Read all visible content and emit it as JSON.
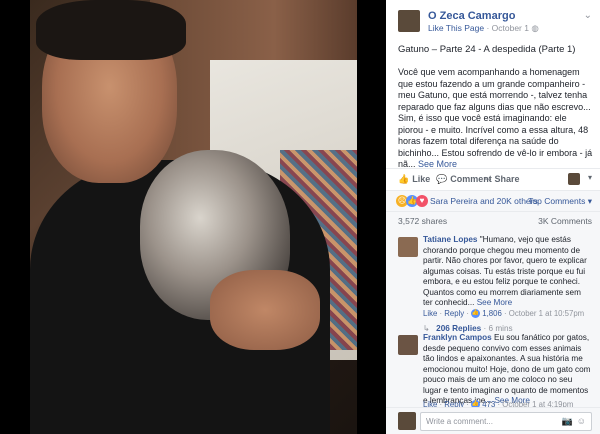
{
  "post": {
    "page_name": "O Zeca Camargo",
    "like_page": "Like This Page",
    "date": "October 1",
    "title": "Gatuno – Parte 24 - A despedida (Parte 1)",
    "body": "Você que vem acompanhando a homenagem que estou fazendo a um grande companheiro - meu Gatuno, que está morrendo -, talvez tenha reparado que faz alguns dias que não escrevo... Sim, é isso que você está imaginando: ele piorou - e muito. Incrível como a essa altura, 48 horas fazem total diferença na saúde do bichinho... Estou sofrendo de vê-lo ir embora - já nã...",
    "see_more": "See More"
  },
  "actions": {
    "like": "Like",
    "comment": "Comment",
    "share": "Share"
  },
  "reactions": {
    "text": "Sara Pereira and 20K others",
    "top_comments": "Top Comments"
  },
  "stats": {
    "shares": "3,572 shares",
    "comments": "3K Comments"
  },
  "comments": [
    {
      "name": "Tatiane Lopes",
      "text": "\"Humano, vejo que estás chorando porque chegou meu momento de partir. Não chores por favor, quero te explicar algumas coisas. Tu estás triste porque eu fui embora, e eu estou feliz porque te conheci. Quantos como eu morrem diariamente sem ter conhecid...",
      "more": "See More",
      "like": "Like",
      "reply": "Reply",
      "likes": "1,806",
      "date": "October 1 at 10:57pm",
      "replies": "206 Replies",
      "replies_ago": "6 mins"
    },
    {
      "name": "Franklyn Campos",
      "text": "Eu sou fanático por gatos, desde pequeno convivo com esses animais tão lindos e apaixonantes. A sua história me emocionou muito! Hoje, dono de um gato com pouco mais de um ano me coloco no seu lugar e tento imaginar o quanto de momentos e lembranças ine...",
      "more": "See More",
      "like": "Like",
      "reply": "Reply",
      "likes": "473",
      "date": "October 1 at 4:19pm"
    }
  ],
  "write": {
    "placeholder": "Write a comment..."
  },
  "colors": {
    "link": "#365899",
    "meta": "#90949c",
    "like_blue": "#5890ff"
  }
}
